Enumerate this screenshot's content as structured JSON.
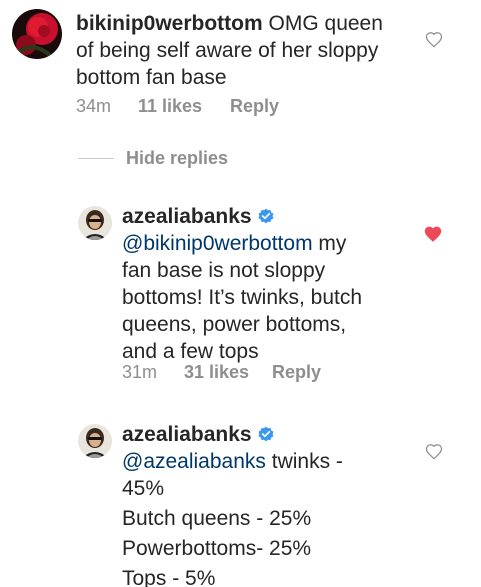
{
  "comments": [
    {
      "username": "bikinip0werbottom",
      "text_lines": [
        " OMG queen",
        "of being self aware of her sloppy",
        "bottom fan base"
      ],
      "time": "34m",
      "likes": "11 likes",
      "reply": "Reply",
      "liked": false,
      "verified": false
    }
  ],
  "hide_replies": "Hide replies",
  "replies": [
    {
      "username": "azealiabanks",
      "mention": "@bikinip0werbottom",
      "first_line_rest": " my",
      "text_lines": [
        "fan base is not sloppy",
        "bottoms! It’s twinks, butch",
        "queens, power bottoms,",
        "and a few tops"
      ],
      "time": "31m",
      "likes": "31 likes",
      "reply": "Reply",
      "liked": true,
      "verified": true
    },
    {
      "username": "azealiabanks",
      "mention": "@azealiabanks",
      "first_line_rest": " twinks -",
      "text_lines": [
        "45%",
        "Butch queens - 25%",
        "Powerbottoms- 25%",
        "Tops - 5%"
      ],
      "liked": false,
      "verified": true
    }
  ],
  "colors": {
    "heart_liked": "#ed4956",
    "heart_unliked": "#8e8e8e",
    "verified_badge": "#3897f0",
    "secondary_text": "#8e8e8e"
  }
}
